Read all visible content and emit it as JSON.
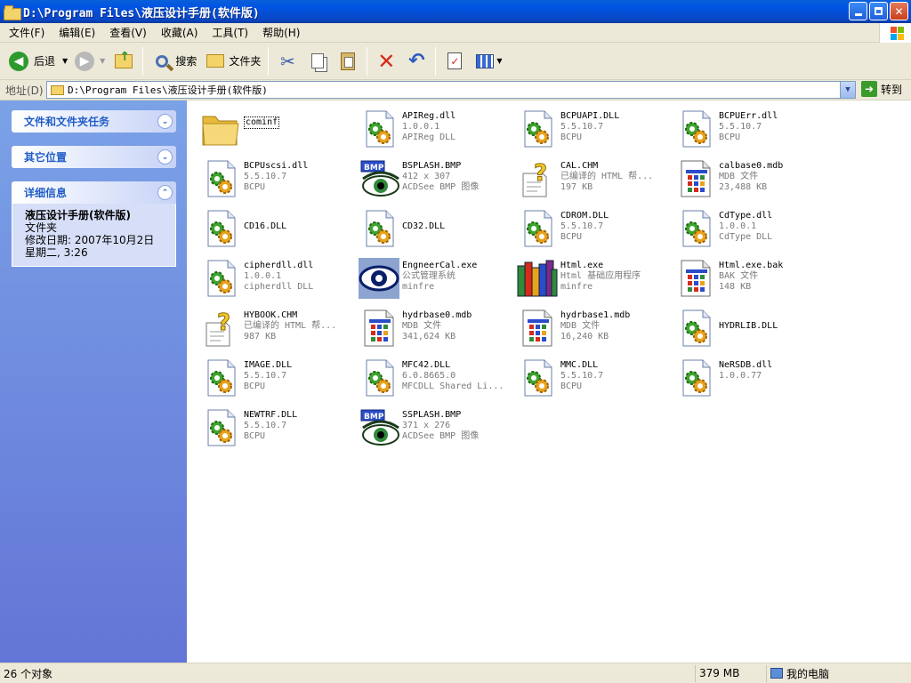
{
  "window": {
    "title": "D:\\Program Files\\液压设计手册(软件版)"
  },
  "menu": [
    "文件(F)",
    "编辑(E)",
    "查看(V)",
    "收藏(A)",
    "工具(T)",
    "帮助(H)"
  ],
  "toolbar": {
    "back": "后退",
    "search": "搜索",
    "folders": "文件夹"
  },
  "address": {
    "label": "地址(D)",
    "value": "D:\\Program Files\\液压设计手册(软件版)",
    "go": "转到"
  },
  "sidebar": {
    "tasks_title": "文件和文件夹任务",
    "other_title": "其它位置",
    "details_title": "详细信息",
    "details": {
      "name": "液压设计手册(软件版)",
      "type": "文件夹",
      "modified_label": "修改日期: 2007年10月2日",
      "modified_time": "星期二, 3:26"
    }
  },
  "files": [
    {
      "name": "cominf",
      "line2": "",
      "line3": "",
      "icon": "folder-icon"
    },
    {
      "name": "APIReg.dll",
      "line2": "1.0.0.1",
      "line3": "APIReg DLL",
      "icon": "dll-icon"
    },
    {
      "name": "BCPUAPI.DLL",
      "line2": "5.5.10.7",
      "line3": "BCPU",
      "icon": "dll-icon"
    },
    {
      "name": "BCPUErr.dll",
      "line2": "5.5.10.7",
      "line3": "BCPU",
      "icon": "dll-icon"
    },
    {
      "name": "BCPUscsi.dll",
      "line2": "5.5.10.7",
      "line3": "BCPU",
      "icon": "dll-icon"
    },
    {
      "name": "BSPLASH.BMP",
      "line2": "412 x 307",
      "line3": "ACDSee BMP 图像",
      "icon": "bmp-icon"
    },
    {
      "name": "CAL.CHM",
      "line2": "已编译的 HTML 帮...",
      "line3": "197 KB",
      "icon": "chm-icon"
    },
    {
      "name": "calbase0.mdb",
      "line2": "MDB 文件",
      "line3": "23,488 KB",
      "icon": "mdb-icon"
    },
    {
      "name": "CD16.DLL",
      "line2": "",
      "line3": "",
      "icon": "dll-icon"
    },
    {
      "name": "CD32.DLL",
      "line2": "",
      "line3": "",
      "icon": "dll-icon"
    },
    {
      "name": "CDROM.DLL",
      "line2": "5.5.10.7",
      "line3": "BCPU",
      "icon": "dll-icon"
    },
    {
      "name": "CdType.dll",
      "line2": "1.0.0.1",
      "line3": "CdType DLL",
      "icon": "dll-icon"
    },
    {
      "name": "cipherdll.dll",
      "line2": "1.0.0.1",
      "line3": "cipherdll DLL",
      "icon": "dll-icon"
    },
    {
      "name": "EngneerCal.exe",
      "line2": "公式管理系统",
      "line3": "minfre",
      "icon": "eye-exe-icon"
    },
    {
      "name": "Html.exe",
      "line2": "Html 基础应用程序",
      "line3": "minfre",
      "icon": "books-exe-icon"
    },
    {
      "name": "Html.exe.bak",
      "line2": "BAK 文件",
      "line3": "148 KB",
      "icon": "bak-icon"
    },
    {
      "name": "HYBOOK.CHM",
      "line2": "已编译的 HTML 帮...",
      "line3": "987 KB",
      "icon": "chm-icon"
    },
    {
      "name": "hydrbase0.mdb",
      "line2": "MDB 文件",
      "line3": "341,624 KB",
      "icon": "mdb-icon"
    },
    {
      "name": "hydrbase1.mdb",
      "line2": "MDB 文件",
      "line3": "16,240 KB",
      "icon": "mdb-icon"
    },
    {
      "name": "HYDRLIB.DLL",
      "line2": "",
      "line3": "",
      "icon": "dll-icon"
    },
    {
      "name": "IMAGE.DLL",
      "line2": "5.5.10.7",
      "line3": "BCPU",
      "icon": "dll-icon"
    },
    {
      "name": "MFC42.DLL",
      "line2": "6.0.8665.0",
      "line3": "MFCDLL Shared Li...",
      "icon": "dll-icon"
    },
    {
      "name": "MMC.DLL",
      "line2": "5.5.10.7",
      "line3": "BCPU",
      "icon": "dll-icon"
    },
    {
      "name": "NeRSDB.dll",
      "line2": "1.0.0.77",
      "line3": "",
      "icon": "dll-icon"
    },
    {
      "name": "NEWTRF.DLL",
      "line2": "5.5.10.7",
      "line3": "BCPU",
      "icon": "dll-icon"
    },
    {
      "name": "SSPLASH.BMP",
      "line2": "371 x 276",
      "line3": "ACDSee BMP 图像",
      "icon": "bmp-icon"
    }
  ],
  "status": {
    "objects": "26 个对象",
    "size": "379 MB",
    "location": "我的电脑"
  }
}
